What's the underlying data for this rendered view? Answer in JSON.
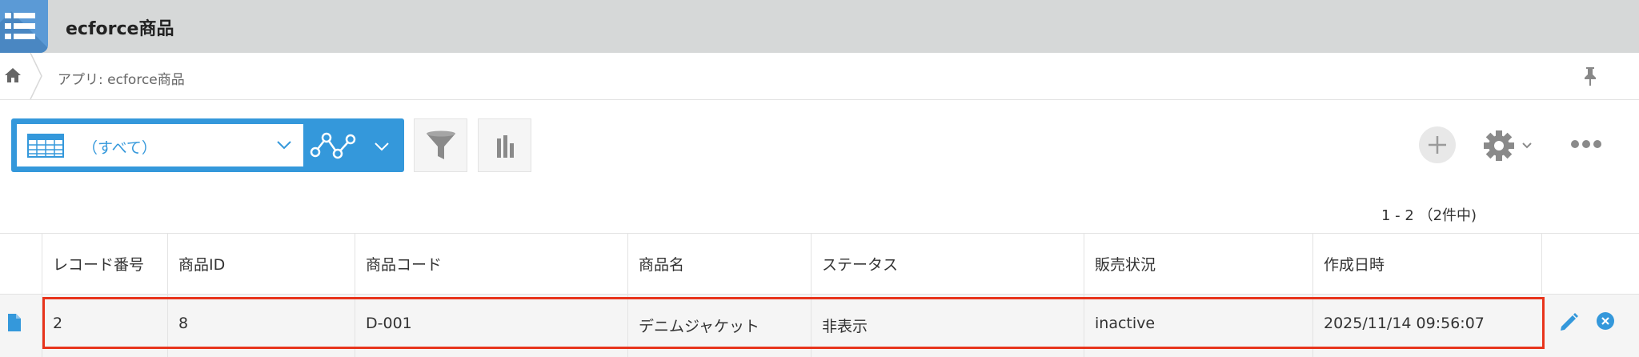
{
  "app": {
    "title": "ecforce商品"
  },
  "breadcrumb": {
    "text": "アプリ: ecforce商品"
  },
  "toolbar": {
    "view_label": "（すべて）"
  },
  "pager": {
    "text": "1 - 2 （2件中)"
  },
  "table": {
    "columns": [
      "レコード番号",
      "商品ID",
      "商品コード",
      "商品名",
      "ステータス",
      "販売状況",
      "作成日時"
    ],
    "rows": [
      [
        "2",
        "8",
        "D-001",
        "デニムジャケット",
        "非表示",
        "inactive",
        "2025/11/14 09:56:07"
      ]
    ]
  },
  "colors": {
    "accent": "#3498db",
    "highlight": "#e8341c",
    "header_bg": "#d6d8d8"
  }
}
